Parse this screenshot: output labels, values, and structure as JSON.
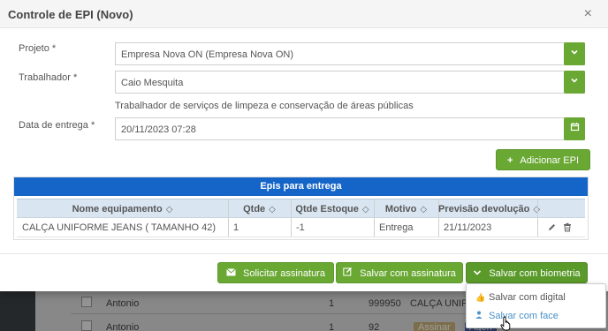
{
  "modal": {
    "title": "Controle de EPI (Novo)",
    "close": "×"
  },
  "form": {
    "projeto_label": "Projeto",
    "projeto_value": "Empresa Nova ON (Empresa Nova ON)",
    "trabalhador_label": "Trabalhador",
    "trabalhador_value": "Caio Mesquita",
    "trabalhador_helper": "Trabalhador de serviços de limpeza e conservação de áreas públicas",
    "data_label": "Data de entrega",
    "data_value": "20/11/2023 07:28",
    "required_mark": "*"
  },
  "actions": {
    "adicionar_epi": "Adicionar EPI"
  },
  "epis_table": {
    "caption": "Epis para entrega",
    "columns": [
      "Nome equipamento",
      "Qtde",
      "Qtde Estoque",
      "Motivo",
      "Previsão devolução"
    ],
    "rows": [
      [
        "CALÇA UNIFORME JEANS ( TAMANHO 42)",
        "1",
        "-1",
        "Entrega",
        "21/11/2023"
      ]
    ]
  },
  "footer": {
    "solicitar_assinatura": "Solicitar assinatura",
    "salvar_com_assinatura": "Salvar com assinatura",
    "salvar_com_biometria": "Salvar com biometria"
  },
  "biometria_menu": {
    "items": [
      "Salvar com digital",
      "Salvar com face"
    ]
  },
  "background_rows": [
    {
      "name": "Antonio",
      "qtde": "1",
      "num": "999950",
      "item": "CALÇA UNIFORME JEANS"
    },
    {
      "name": "Antonio",
      "qtde": "1",
      "num": "92",
      "item": ""
    }
  ],
  "background_buttons": {
    "assinar": "Assinar",
    "agendar": "Agen"
  },
  "colors": {
    "green": "#6aa834",
    "blue_caption": "#1565c8",
    "header_row": "#d9e6f2"
  }
}
